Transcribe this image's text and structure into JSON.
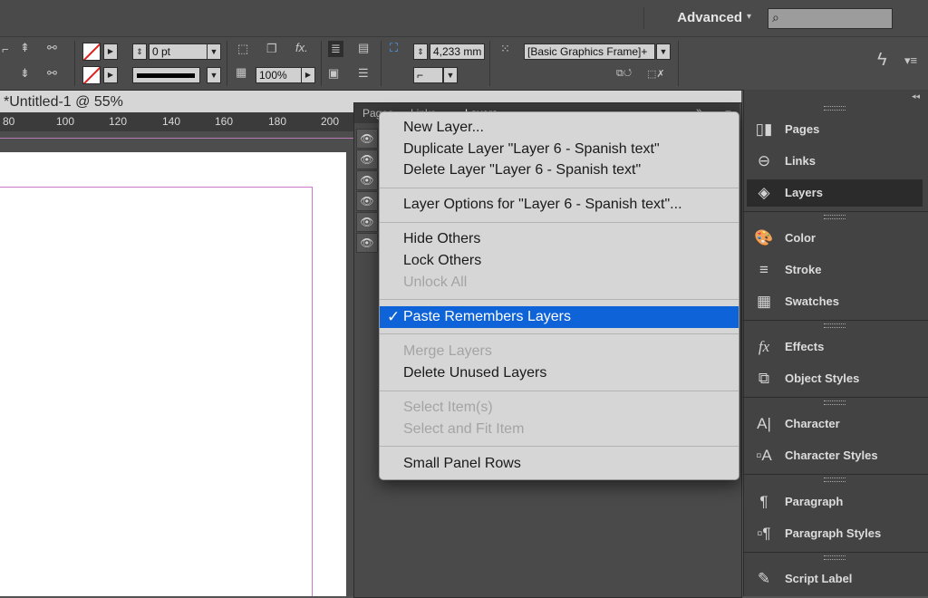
{
  "app_bar": {
    "workspace": "Advanced",
    "search_placeholder": ""
  },
  "control_bar": {
    "stroke_weight": "0 pt",
    "opacity": "100%",
    "width_value": "4,233 mm",
    "frame_style": "[Basic Graphics Frame]+"
  },
  "document": {
    "title": "*Untitled-1 @ 55%",
    "ruler_ticks": [
      "80",
      "100",
      "120",
      "140",
      "160",
      "180",
      "200"
    ]
  },
  "panel_tabs": [
    "Pages",
    "Links",
    "Layers"
  ],
  "menu": {
    "items": [
      {
        "label": "New Layer...",
        "enabled": true
      },
      {
        "label": "Duplicate Layer \"Layer 6 - Spanish text\"",
        "enabled": true
      },
      {
        "label": "Delete Layer \"Layer 6 - Spanish text\"",
        "enabled": true
      },
      {
        "label": "Layer Options for \"Layer 6 - Spanish text\"...",
        "enabled": true
      },
      {
        "label": "Hide Others",
        "enabled": true
      },
      {
        "label": "Lock Others",
        "enabled": true
      },
      {
        "label": "Unlock All",
        "enabled": false
      },
      {
        "label": "Paste Remembers Layers",
        "enabled": true,
        "checked": true
      },
      {
        "label": "Merge Layers",
        "enabled": false
      },
      {
        "label": "Delete Unused Layers",
        "enabled": true
      },
      {
        "label": "Select Item(s)",
        "enabled": false
      },
      {
        "label": "Select and Fit Item",
        "enabled": false
      },
      {
        "label": "Small Panel Rows",
        "enabled": true
      }
    ],
    "check_mark": "✓"
  },
  "dock": {
    "items": [
      {
        "label": "Pages",
        "icon": "pages-icon"
      },
      {
        "label": "Links",
        "icon": "links-icon"
      },
      {
        "label": "Layers",
        "icon": "layers-icon"
      },
      {
        "label": "Color",
        "icon": "color-icon"
      },
      {
        "label": "Stroke",
        "icon": "stroke-icon"
      },
      {
        "label": "Swatches",
        "icon": "swatches-icon"
      },
      {
        "label": "Effects",
        "icon": "effects-icon"
      },
      {
        "label": "Object Styles",
        "icon": "object-styles-icon"
      },
      {
        "label": "Character",
        "icon": "character-icon"
      },
      {
        "label": "Character Styles",
        "icon": "character-styles-icon"
      },
      {
        "label": "Paragraph",
        "icon": "paragraph-icon"
      },
      {
        "label": "Paragraph Styles",
        "icon": "paragraph-styles-icon"
      },
      {
        "label": "Script Label",
        "icon": "script-label-icon"
      }
    ]
  },
  "colors": {
    "menu_highlight": "#0d63d7",
    "guide": "#c97acb"
  }
}
